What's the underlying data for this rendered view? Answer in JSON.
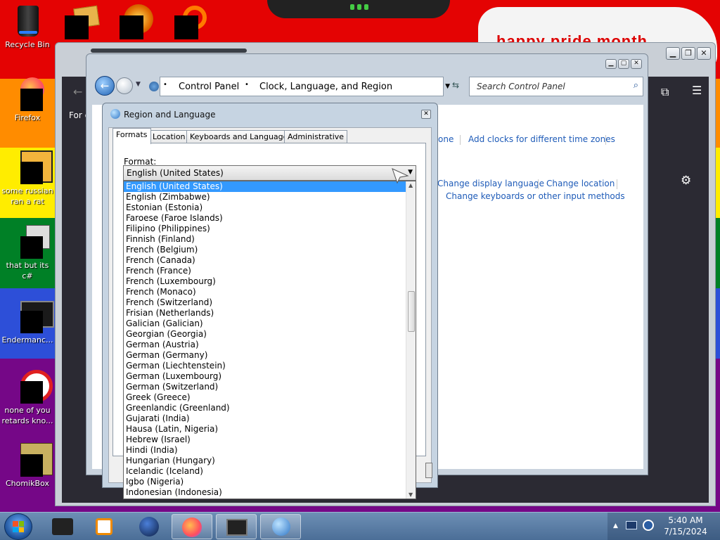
{
  "desktop": {
    "banner_text": "happy pride month",
    "icons": [
      {
        "label": "Recycle Bin",
        "icon": "recycle-bin-icon"
      },
      {
        "label": "Firefox",
        "icon": "firefox-icon"
      },
      {
        "label": "some russian ran a rat",
        "icon": "app-icon"
      },
      {
        "label": "that but its c#",
        "icon": "app-icon"
      },
      {
        "label": "Endermanc...",
        "icon": "app-icon"
      },
      {
        "label": "none of you retards kno...",
        "icon": "app-icon"
      },
      {
        "label": "ChomikBox",
        "icon": "chomikbox-icon"
      }
    ]
  },
  "browser": {
    "partial_text": "For c"
  },
  "control_panel": {
    "breadcrumb": [
      "Control Panel",
      "Clock, Language, and Region"
    ],
    "search_placeholder": "Search Control Panel",
    "links": {
      "time_zone_partial": "one",
      "add_clocks": "Add clocks for different time zones",
      "change_display_language": "Change display language",
      "change_location": "Change location",
      "change_keyboards": "Change keyboards or other input methods"
    }
  },
  "dialog": {
    "title": "Region and Language",
    "tabs": [
      "Formats",
      "Location",
      "Keyboards and Languages",
      "Administrative"
    ],
    "active_tab": "Formats",
    "format_label": "Format:",
    "selected_format": "English (United States)",
    "dropdown_options": [
      "English (United States)",
      "English (Zimbabwe)",
      "Estonian (Estonia)",
      "Faroese (Faroe Islands)",
      "Filipino (Philippines)",
      "Finnish (Finland)",
      "French (Belgium)",
      "French (Canada)",
      "French (France)",
      "French (Luxembourg)",
      "French (Monaco)",
      "French (Switzerland)",
      "Frisian (Netherlands)",
      "Galician (Galician)",
      "Georgian (Georgia)",
      "German (Austria)",
      "German (Germany)",
      "German (Liechtenstein)",
      "German (Luxembourg)",
      "German (Switzerland)",
      "Greek (Greece)",
      "Greenlandic (Greenland)",
      "Gujarati (India)",
      "Hausa (Latin, Nigeria)",
      "Hebrew (Israel)",
      "Hindi (India)",
      "Hungarian (Hungary)",
      "Icelandic (Iceland)",
      "Igbo (Nigeria)",
      "Indonesian (Indonesia)"
    ]
  },
  "taskbar": {
    "time": "5:40 AM",
    "date": "7/15/2024"
  },
  "colors": {
    "selection": "#3399ff",
    "link": "#1e5bb8"
  }
}
